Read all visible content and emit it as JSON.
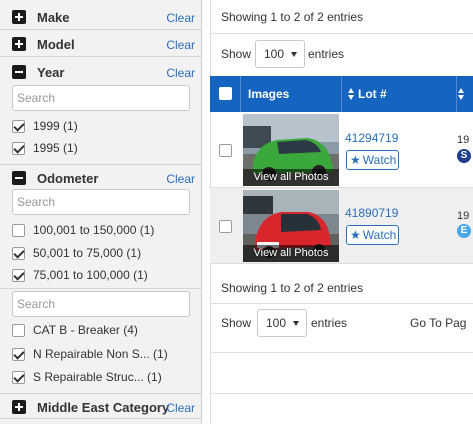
{
  "sidebar": {
    "clear_label": "Clear",
    "sections": {
      "make": {
        "title": "Make",
        "expanded": false
      },
      "model": {
        "title": "Model",
        "expanded": false
      },
      "year": {
        "title": "Year",
        "expanded": true,
        "search_placeholder": "Search",
        "options": [
          {
            "label": "1999 (1)",
            "checked": true
          },
          {
            "label": "1995 (1)",
            "checked": true
          }
        ]
      },
      "odometer": {
        "title": "Odometer",
        "expanded": true,
        "search_placeholder": "Search",
        "options": [
          {
            "label": "100,001 to 150,000 (1)",
            "checked": false
          },
          {
            "label": "50,001 to 75,000 (1)",
            "checked": true
          },
          {
            "label": "75,001 to 100,000 (1)",
            "checked": true
          }
        ]
      },
      "category": {
        "search_placeholder": "Search",
        "options": [
          {
            "label": "CAT B - Breaker (4)",
            "checked": false
          },
          {
            "label": "N Repairable Non S... (1)",
            "checked": true
          },
          {
            "label": "S Repairable Struc... (1)",
            "checked": true
          }
        ]
      },
      "middle_east": {
        "title": "Middle East Category",
        "expanded": false
      }
    }
  },
  "main": {
    "info_top": "Showing 1 to 2 of 2 entries",
    "show_label": "Show",
    "entries_label": "entries",
    "page_size": "100",
    "columns": {
      "images": "Images",
      "lot": "Lot #",
      "year": "Y"
    },
    "rows": [
      {
        "photo_caption": "View all Photos",
        "lot": "41294719",
        "watch": "Watch",
        "year": "19",
        "badge": "S",
        "badge_color": "#1f3f8f",
        "car_color": "#3aa83a"
      },
      {
        "photo_caption": "View all Photos",
        "lot": "41890719",
        "watch": "Watch",
        "year": "19",
        "badge": "E",
        "badge_color": "#4aa6e8",
        "car_color": "#d9262d"
      }
    ],
    "info_bottom": "Showing 1 to 2 of 2 entries",
    "show_label_bottom": "Show",
    "page_size_bottom": "100",
    "entries_label_bottom": "entries",
    "goto_label": "Go To Pag"
  }
}
